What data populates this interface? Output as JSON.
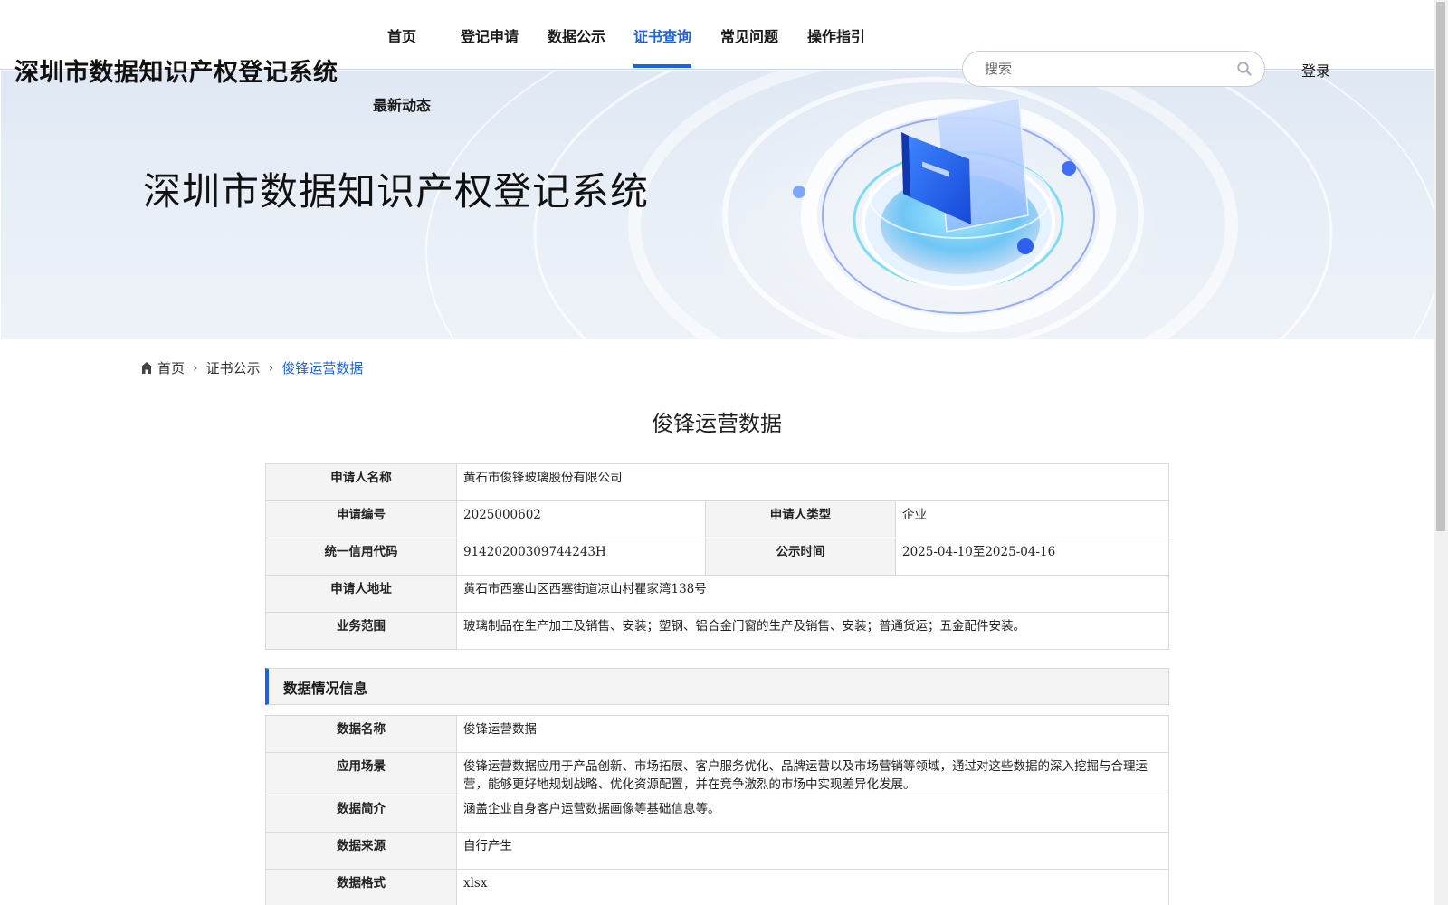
{
  "header": {
    "site_title": "深圳市数据知识产权登记系统",
    "nav": [
      {
        "label": "首页",
        "active": false
      },
      {
        "label": "登记申请",
        "active": false
      },
      {
        "label": "数据公示",
        "active": false
      },
      {
        "label": "证书查询",
        "active": true
      },
      {
        "label": "常见问题",
        "active": false
      },
      {
        "label": "操作指引",
        "active": false
      },
      {
        "label": "最新动态",
        "active": false
      }
    ],
    "search_placeholder": "搜索",
    "login_label": "登录"
  },
  "banner": {
    "title": "深圳市数据知识产权登记系统"
  },
  "breadcrumb": {
    "items": [
      "首页",
      "证书公示",
      "俊锋运营数据"
    ]
  },
  "page_title": "俊锋运营数据",
  "applicant": {
    "name_label": "申请人名称",
    "name_value": "黄石市俊锋玻璃股份有限公司",
    "number_label": "申请编号",
    "number_value": "2025000602",
    "type_label": "申请人类型",
    "type_value": "企业",
    "credit_label": "统一信用代码",
    "credit_value": "91420200309744243H",
    "publicity_label": "公示时间",
    "publicity_value": "2025-04-10至2025-04-16",
    "address_label": "申请人地址",
    "address_value": "黄石市西塞山区西塞街道凉山村瞿家湾138号",
    "scope_label": "业务范围",
    "scope_value": "玻璃制品在生产加工及销售、安装；塑钢、铝合金门窗的生产及销售、安装；普通货运；五金配件安装。"
  },
  "data_section": {
    "title": "数据情况信息",
    "rows": [
      {
        "label": "数据名称",
        "value": "俊锋运营数据"
      },
      {
        "label": "应用场景",
        "value": "俊锋运营数据应用于产品创新、市场拓展、客户服务优化、品牌运营以及市场营销等领域，通过对这些数据的深入挖掘与合理运营，能够更好地规划战略、优化资源配置，并在竞争激烈的市场中实现差异化发展。"
      },
      {
        "label": "数据简介",
        "value": "涵盖企业自身客户运营数据画像等基础信息等。"
      },
      {
        "label": "数据来源",
        "value": "自行产生"
      },
      {
        "label": "数据格式",
        "value": "xlsx"
      }
    ]
  },
  "colors": {
    "accent": "#1d63e0",
    "label_bg": "#f4f4f5",
    "border": "#d6d9de"
  }
}
